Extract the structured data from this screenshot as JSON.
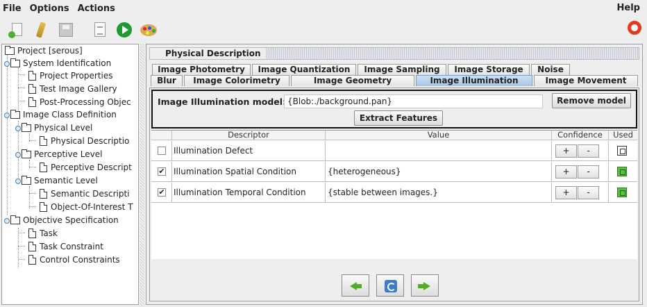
{
  "menu": {
    "file": "File",
    "options": "Options",
    "actions": "Actions",
    "help": "Help"
  },
  "toolbar": {
    "icons": [
      "new-document-icon",
      "brush-icon",
      "save-icon",
      "report-icon",
      "run-icon",
      "palette-icon"
    ],
    "help_icon": "lifebuoy-icon"
  },
  "tree": {
    "items": [
      {
        "label": "Project [serous]"
      },
      {
        "label": "System Identification"
      },
      {
        "label": "Project Properties"
      },
      {
        "label": "Test Image Gallery"
      },
      {
        "label": "Post-Processing Objec"
      },
      {
        "label": "Image Class Definition"
      },
      {
        "label": "Physical Level"
      },
      {
        "label": "Physical Descriptio"
      },
      {
        "label": "Perceptive Level"
      },
      {
        "label": "Perceptive Descript"
      },
      {
        "label": "Semantic Level"
      },
      {
        "label": "Semantic Descripti"
      },
      {
        "label": "Object-Of-Interest T"
      },
      {
        "label": "Objective Specification"
      },
      {
        "label": "Task"
      },
      {
        "label": "Task Constraint"
      },
      {
        "label": "Control Constraints"
      }
    ]
  },
  "panel": {
    "title": "Physical Description",
    "tabs_row1": [
      "Image Photometry",
      "Image Quantization",
      "Image Sampling",
      "Image Storage",
      "Noise"
    ],
    "tabs_row2": [
      "Blur",
      "Image Colorimetry",
      "Image Geometry",
      "Image Illumination",
      "Image Movement"
    ],
    "active_tab": "Image Illumination",
    "model_label": "Image Illumination model:",
    "model_value": "{Blob:./background.pan}",
    "remove_button": "Remove model",
    "extract_button": "Extract Features",
    "columns": [
      "Descriptor",
      "Value",
      "Confidence",
      "Used"
    ],
    "rows": [
      {
        "checked": false,
        "check": "",
        "descriptor": "Illumination Defect",
        "value": "",
        "used": false
      },
      {
        "checked": true,
        "check": "✔",
        "descriptor": "Illumination Spatial Condition",
        "value": "{heterogeneous}",
        "used": true
      },
      {
        "checked": true,
        "check": "✔",
        "descriptor": "Illumination Temporal Condition",
        "value": "{stable between images.}",
        "used": true
      }
    ],
    "confidence_plus": "+",
    "confidence_minus": "-",
    "nav": [
      "arrow-left-icon",
      "refresh-icon",
      "arrow-right-icon"
    ]
  },
  "colors": {
    "accent_tab": "#a8c6e6",
    "used_green": "#58c23a",
    "nav_green": "#4fb028"
  }
}
